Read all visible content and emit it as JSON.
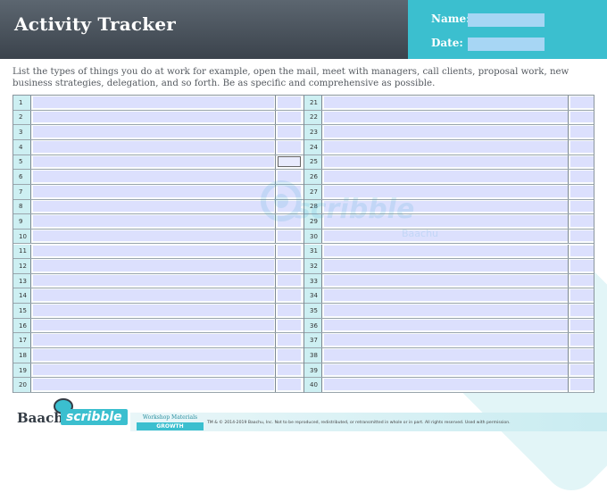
{
  "header": {
    "title": "Activity Tracker",
    "name_label": "Name:",
    "name_value": "",
    "date_label": "Date:",
    "date_value": ""
  },
  "instructions": "List the types of things you do at work for example, open the mail, meet with managers, call clients, proposal work, new business strategies, delegation, and so forth. Be as specific and comprehensive as possible.",
  "rows_left": [
    "1",
    "2",
    "3",
    "4",
    "5",
    "6",
    "7",
    "8",
    "9",
    "10",
    "11",
    "12",
    "13",
    "14",
    "15",
    "16",
    "17",
    "18",
    "19",
    "20"
  ],
  "rows_right": [
    "21",
    "22",
    "23",
    "24",
    "25",
    "26",
    "27",
    "28",
    "29",
    "30",
    "31",
    "32",
    "33",
    "34",
    "35",
    "36",
    "37",
    "38",
    "39",
    "40"
  ],
  "watermark": {
    "text": "scribble",
    "sub": "Baachu"
  },
  "footer": {
    "logo_baachu": "Baachu",
    "logo_scribble": "scribble",
    "workshop_label": "Workshop Materials",
    "category": "GROWTH",
    "copyright": "TM & © 2014-2019 Baachu, Inc. Not to be reproduced, redistributed, or retransmitted in whole or in part. All rights reserved. Used with permission."
  },
  "colors": {
    "header_dark": "#3b434c",
    "accent": "#3bbfcf",
    "field": "#dce0fd",
    "number_cell": "#cdeff2"
  }
}
